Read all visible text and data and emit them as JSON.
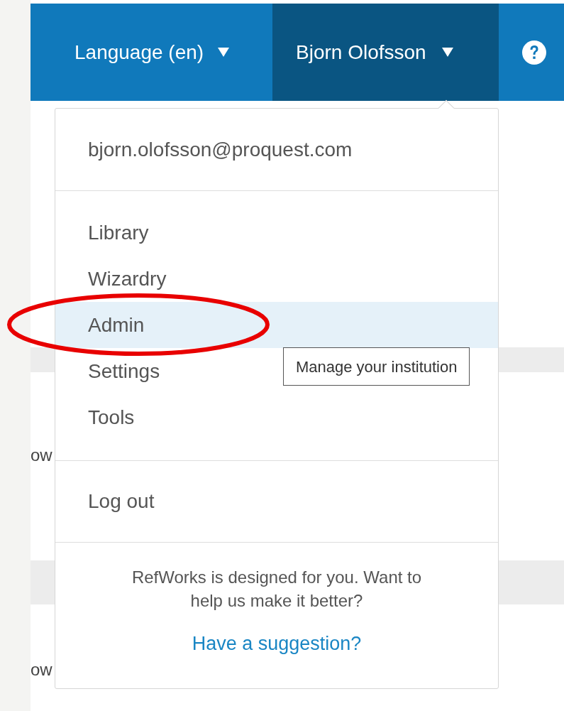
{
  "header": {
    "language_menu": {
      "label": "Language (en)"
    },
    "user_menu": {
      "label": "Bjorn Olofsson",
      "expanded": true
    }
  },
  "background_fragments": [
    "ow",
    "ow"
  ],
  "user_dropdown": {
    "email": "bjorn.olofsson@proquest.com",
    "items": [
      {
        "label": "Library",
        "selected": false
      },
      {
        "label": "Wizardry",
        "selected": false
      },
      {
        "label": "Admin",
        "selected": true
      },
      {
        "label": "Settings",
        "selected": false
      },
      {
        "label": "Tools",
        "selected": false
      }
    ],
    "logout": "Log out",
    "feedback": {
      "text": "RefWorks is designed for you. Want to help us make it better?",
      "link": "Have a suggestion?"
    }
  },
  "tooltip": {
    "text": "Manage your institution"
  }
}
